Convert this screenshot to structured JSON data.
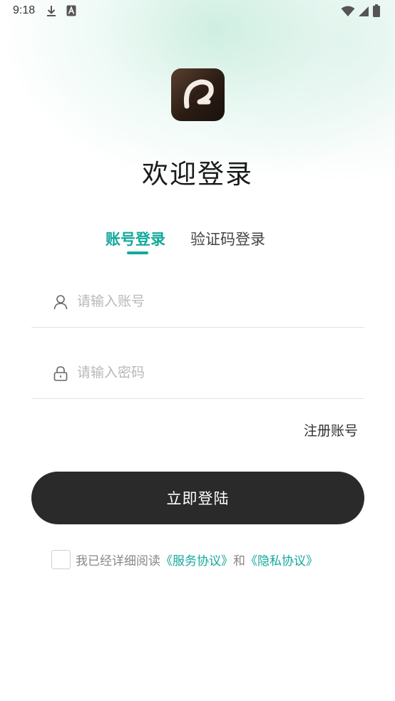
{
  "status_bar": {
    "time": "9:18"
  },
  "header": {
    "title": "欢迎登录"
  },
  "tabs": [
    {
      "label": "账号登录",
      "active": true
    },
    {
      "label": "验证码登录",
      "active": false
    }
  ],
  "form": {
    "account_placeholder": "请输入账号",
    "password_placeholder": "请输入密码",
    "register_label": "注册账号",
    "login_label": "立即登陆"
  },
  "agreement": {
    "prefix": "我已经详细阅读",
    "service_link": "《服务协议》",
    "conjunction": "和",
    "privacy_link": "《隐私协议》",
    "checked": false
  },
  "colors": {
    "accent": "#12a99b",
    "button": "#2b2a2a"
  }
}
